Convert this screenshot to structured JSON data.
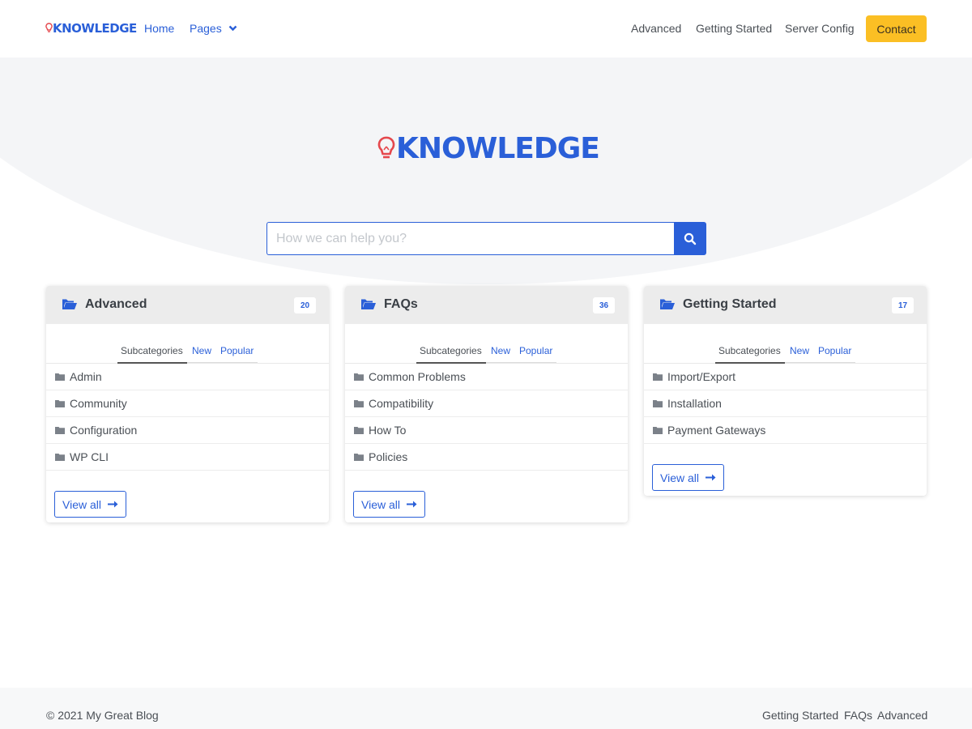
{
  "brand": {
    "name": "KNOWLEDGE",
    "color": "#2a5fd8",
    "bulb_color": "#e5484d"
  },
  "nav": {
    "home": "Home",
    "pages": "Pages",
    "right_links": [
      "Advanced",
      "Getting Started",
      "Server Config"
    ],
    "contact": "Contact",
    "contact_color": "#fbbf24"
  },
  "search": {
    "placeholder": "How we can help you?",
    "icon": "search-icon"
  },
  "tabs": {
    "subcategories": "Subcategories",
    "new": "New",
    "popular": "Popular"
  },
  "cards": [
    {
      "title": "Advanced",
      "count": "20",
      "items": [
        "Admin",
        "Community",
        "Configuration",
        "WP CLI"
      ],
      "view_all": "View all"
    },
    {
      "title": "FAQs",
      "count": "36",
      "items": [
        "Common Problems",
        "Compatibility",
        "How To",
        "Policies"
      ],
      "view_all": "View all"
    },
    {
      "title": "Getting Started",
      "count": "17",
      "items": [
        "Import/Export",
        "Installation",
        "Payment Gateways"
      ],
      "view_all": "View all"
    }
  ],
  "footer": {
    "copyright": "© 2021 My Great Blog",
    "links": [
      "Getting Started",
      "FAQs",
      "Advanced"
    ]
  }
}
